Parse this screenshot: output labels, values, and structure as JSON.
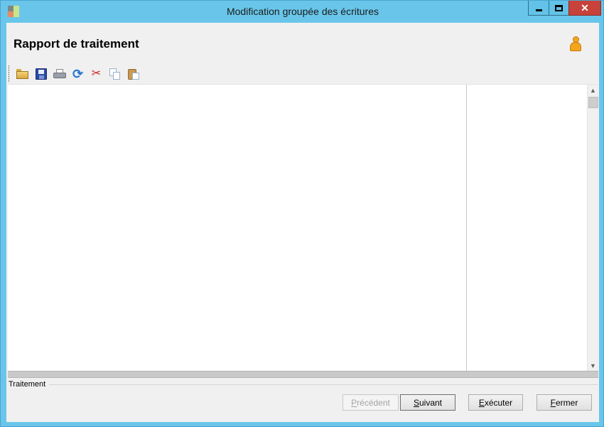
{
  "window": {
    "title": "Modification groupée des écritures",
    "colors": {
      "frame": "#69c6ea",
      "close_button": "#c7423a",
      "client": "#f0f0f0"
    }
  },
  "header": {
    "title": "Rapport de traitement",
    "user_icon": "user-icon"
  },
  "toolbar": {
    "items": [
      {
        "name": "open",
        "icon": "folder-icon"
      },
      {
        "name": "save",
        "icon": "save-icon"
      },
      {
        "name": "print",
        "icon": "print-icon"
      },
      {
        "name": "refresh",
        "icon": "refresh-icon"
      },
      {
        "name": "cut",
        "icon": "cut-icon"
      },
      {
        "name": "copy",
        "icon": "copy-icon"
      },
      {
        "name": "paste",
        "icon": "paste-icon"
      }
    ]
  },
  "status_group": {
    "label": "Traitement"
  },
  "buttons": {
    "previous": {
      "mnemonic": "P",
      "rest": "récédent",
      "enabled": false
    },
    "next": {
      "mnemonic": "S",
      "rest": "uivant",
      "enabled": true
    },
    "execute": {
      "mnemonic": "E",
      "rest": "xécuter",
      "enabled": true
    },
    "close": {
      "mnemonic": "F",
      "rest": "ermer",
      "enabled": true
    }
  },
  "glyphs": {
    "scroll_up": "▲",
    "scroll_down": "▼",
    "close": "✕",
    "refresh": "⟳",
    "cut": "✂"
  }
}
